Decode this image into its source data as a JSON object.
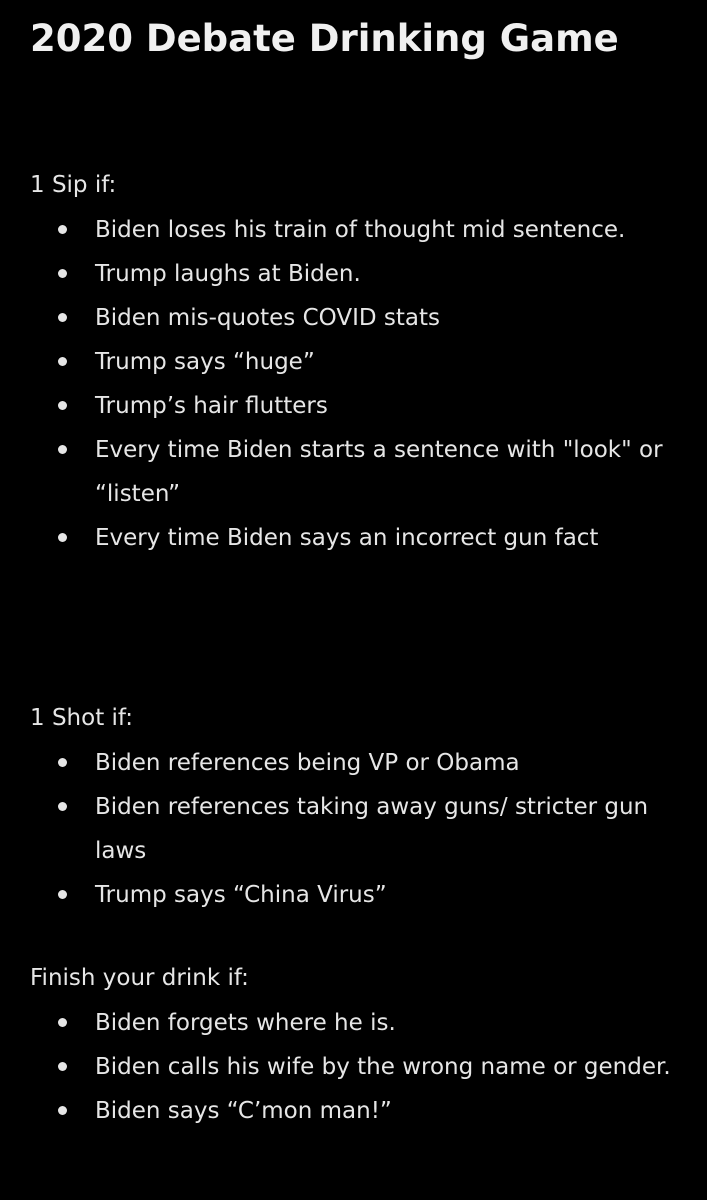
{
  "title": "2020 Debate Drinking Game",
  "sections": [
    {
      "heading": "1 Sip if:",
      "items": [
        "Biden loses his train of thought mid sentence.",
        "Trump laughs at Biden.",
        "Biden mis-quotes COVID stats",
        "Trump says “huge”",
        "Trump’s hair flutters",
        "Every time Biden starts a sentence with \"look\" or “listen”",
        "Every time Biden says an incorrect gun fact"
      ]
    },
    {
      "heading": "1 Shot if:",
      "items": [
        "Biden references being VP or Obama",
        "Biden references taking away guns/ stricter gun laws",
        "Trump says “China Virus”"
      ]
    },
    {
      "heading": "Finish your drink if:",
      "items": [
        "Biden forgets where he is.",
        "Biden calls his wife by the wrong name or gender.",
        "Biden says “C’mon man!”"
      ]
    }
  ]
}
